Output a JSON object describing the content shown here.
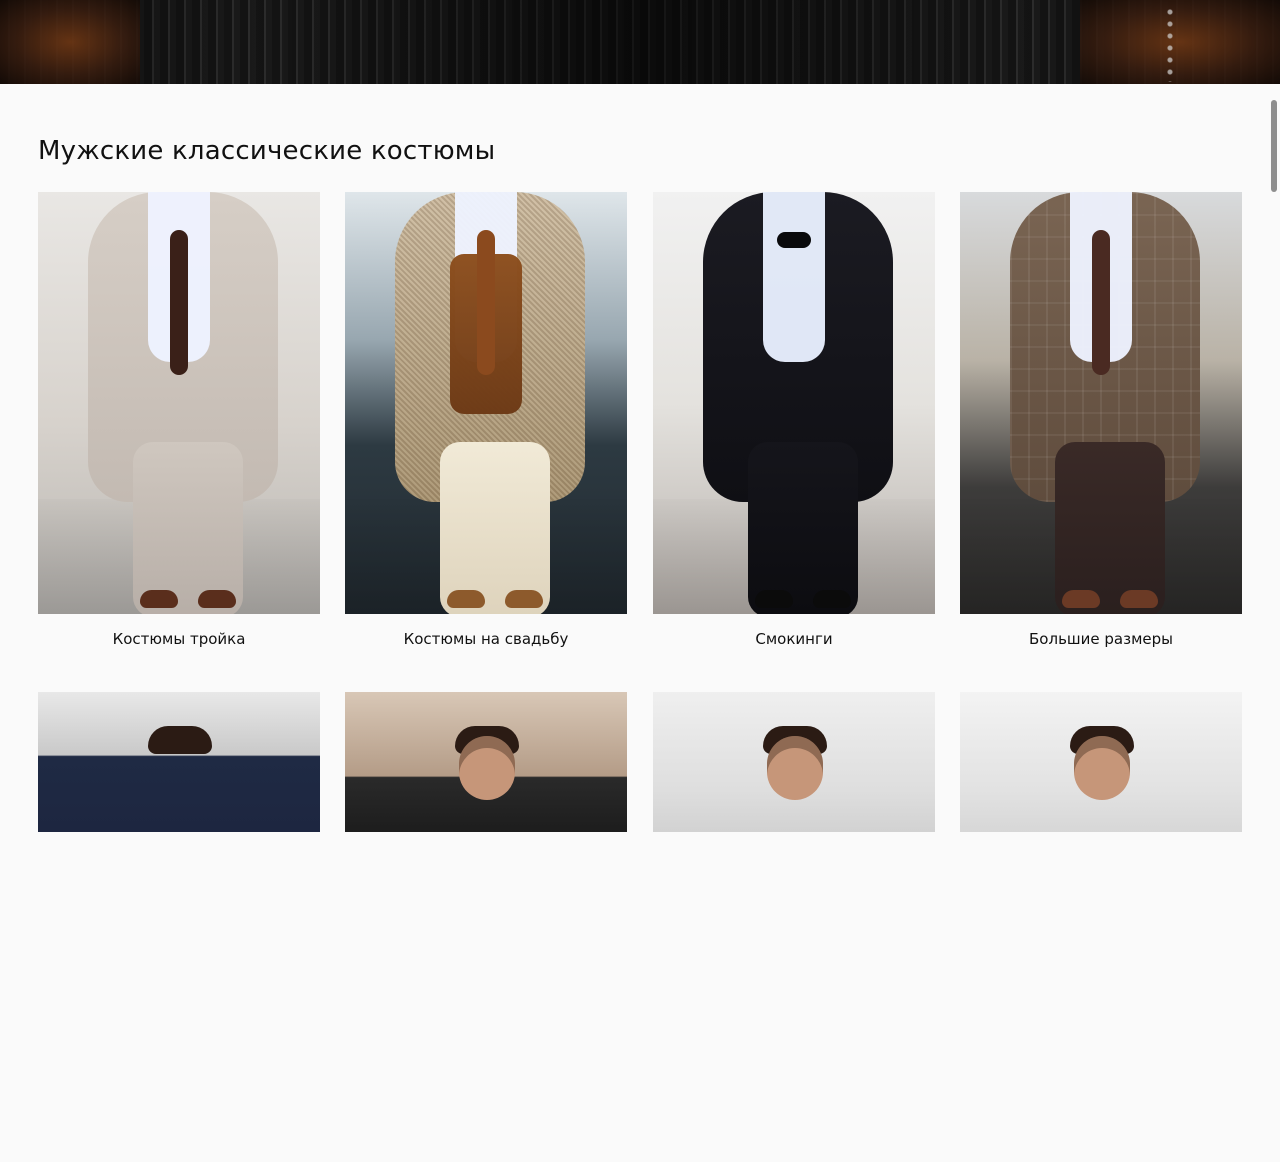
{
  "section": {
    "title": "Мужские классические костюмы"
  },
  "categories": [
    {
      "label": "Костюмы тройка"
    },
    {
      "label": "Костюмы на свадьбу"
    },
    {
      "label": "Смокинги"
    },
    {
      "label": "Большие размеры"
    }
  ],
  "colors": {
    "page_bg": "#fafafa",
    "text": "#111111"
  },
  "icons": {
    "scrollbar": "scrollbar-thumb"
  }
}
